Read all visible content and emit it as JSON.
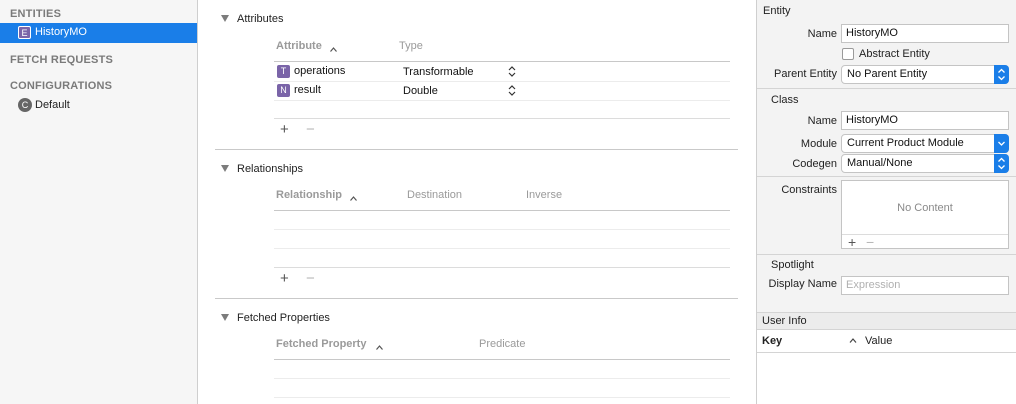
{
  "sidebar": {
    "entities_header": "ENTITIES",
    "entity_item": {
      "badge": "E",
      "label": "HistoryMO"
    },
    "fetch_requests_header": "FETCH REQUESTS",
    "configurations_header": "CONFIGURATIONS",
    "configuration_item": {
      "badge": "C",
      "label": "Default"
    }
  },
  "attributes": {
    "title": "Attributes",
    "col_attribute": "Attribute",
    "col_type": "Type",
    "rows": [
      {
        "badge": "T",
        "name": "operations",
        "type": "Transformable"
      },
      {
        "badge": "N",
        "name": "result",
        "type": "Double"
      }
    ],
    "add": "+",
    "remove": "−"
  },
  "relationships": {
    "title": "Relationships",
    "col_relationship": "Relationship",
    "col_destination": "Destination",
    "col_inverse": "Inverse",
    "add": "+",
    "remove": "−"
  },
  "fetched_properties": {
    "title": "Fetched Properties",
    "col_fetched_property": "Fetched Property",
    "col_predicate": "Predicate"
  },
  "inspector": {
    "entity_header": "Entity",
    "name_label": "Name",
    "name_value": "HistoryMO",
    "abstract_label": "Abstract Entity",
    "parent_label": "Parent Entity",
    "parent_value": "No Parent Entity",
    "class_header": "Class",
    "class_name_label": "Name",
    "class_name_value": "HistoryMO",
    "module_label": "Module",
    "module_value": "Current Product Module",
    "codegen_label": "Codegen",
    "codegen_value": "Manual/None",
    "constraints_label": "Constraints",
    "constraints_empty": "No Content",
    "constraints_add": "+",
    "constraints_remove": "−",
    "spotlight_header": "Spotlight",
    "display_name_label": "Display Name",
    "display_name_placeholder": "Expression",
    "user_info_header": "User Info",
    "key_label": "Key",
    "value_label": "Value"
  },
  "colors": {
    "accent": "#1a7ee8",
    "badge": "#7a64a8"
  }
}
